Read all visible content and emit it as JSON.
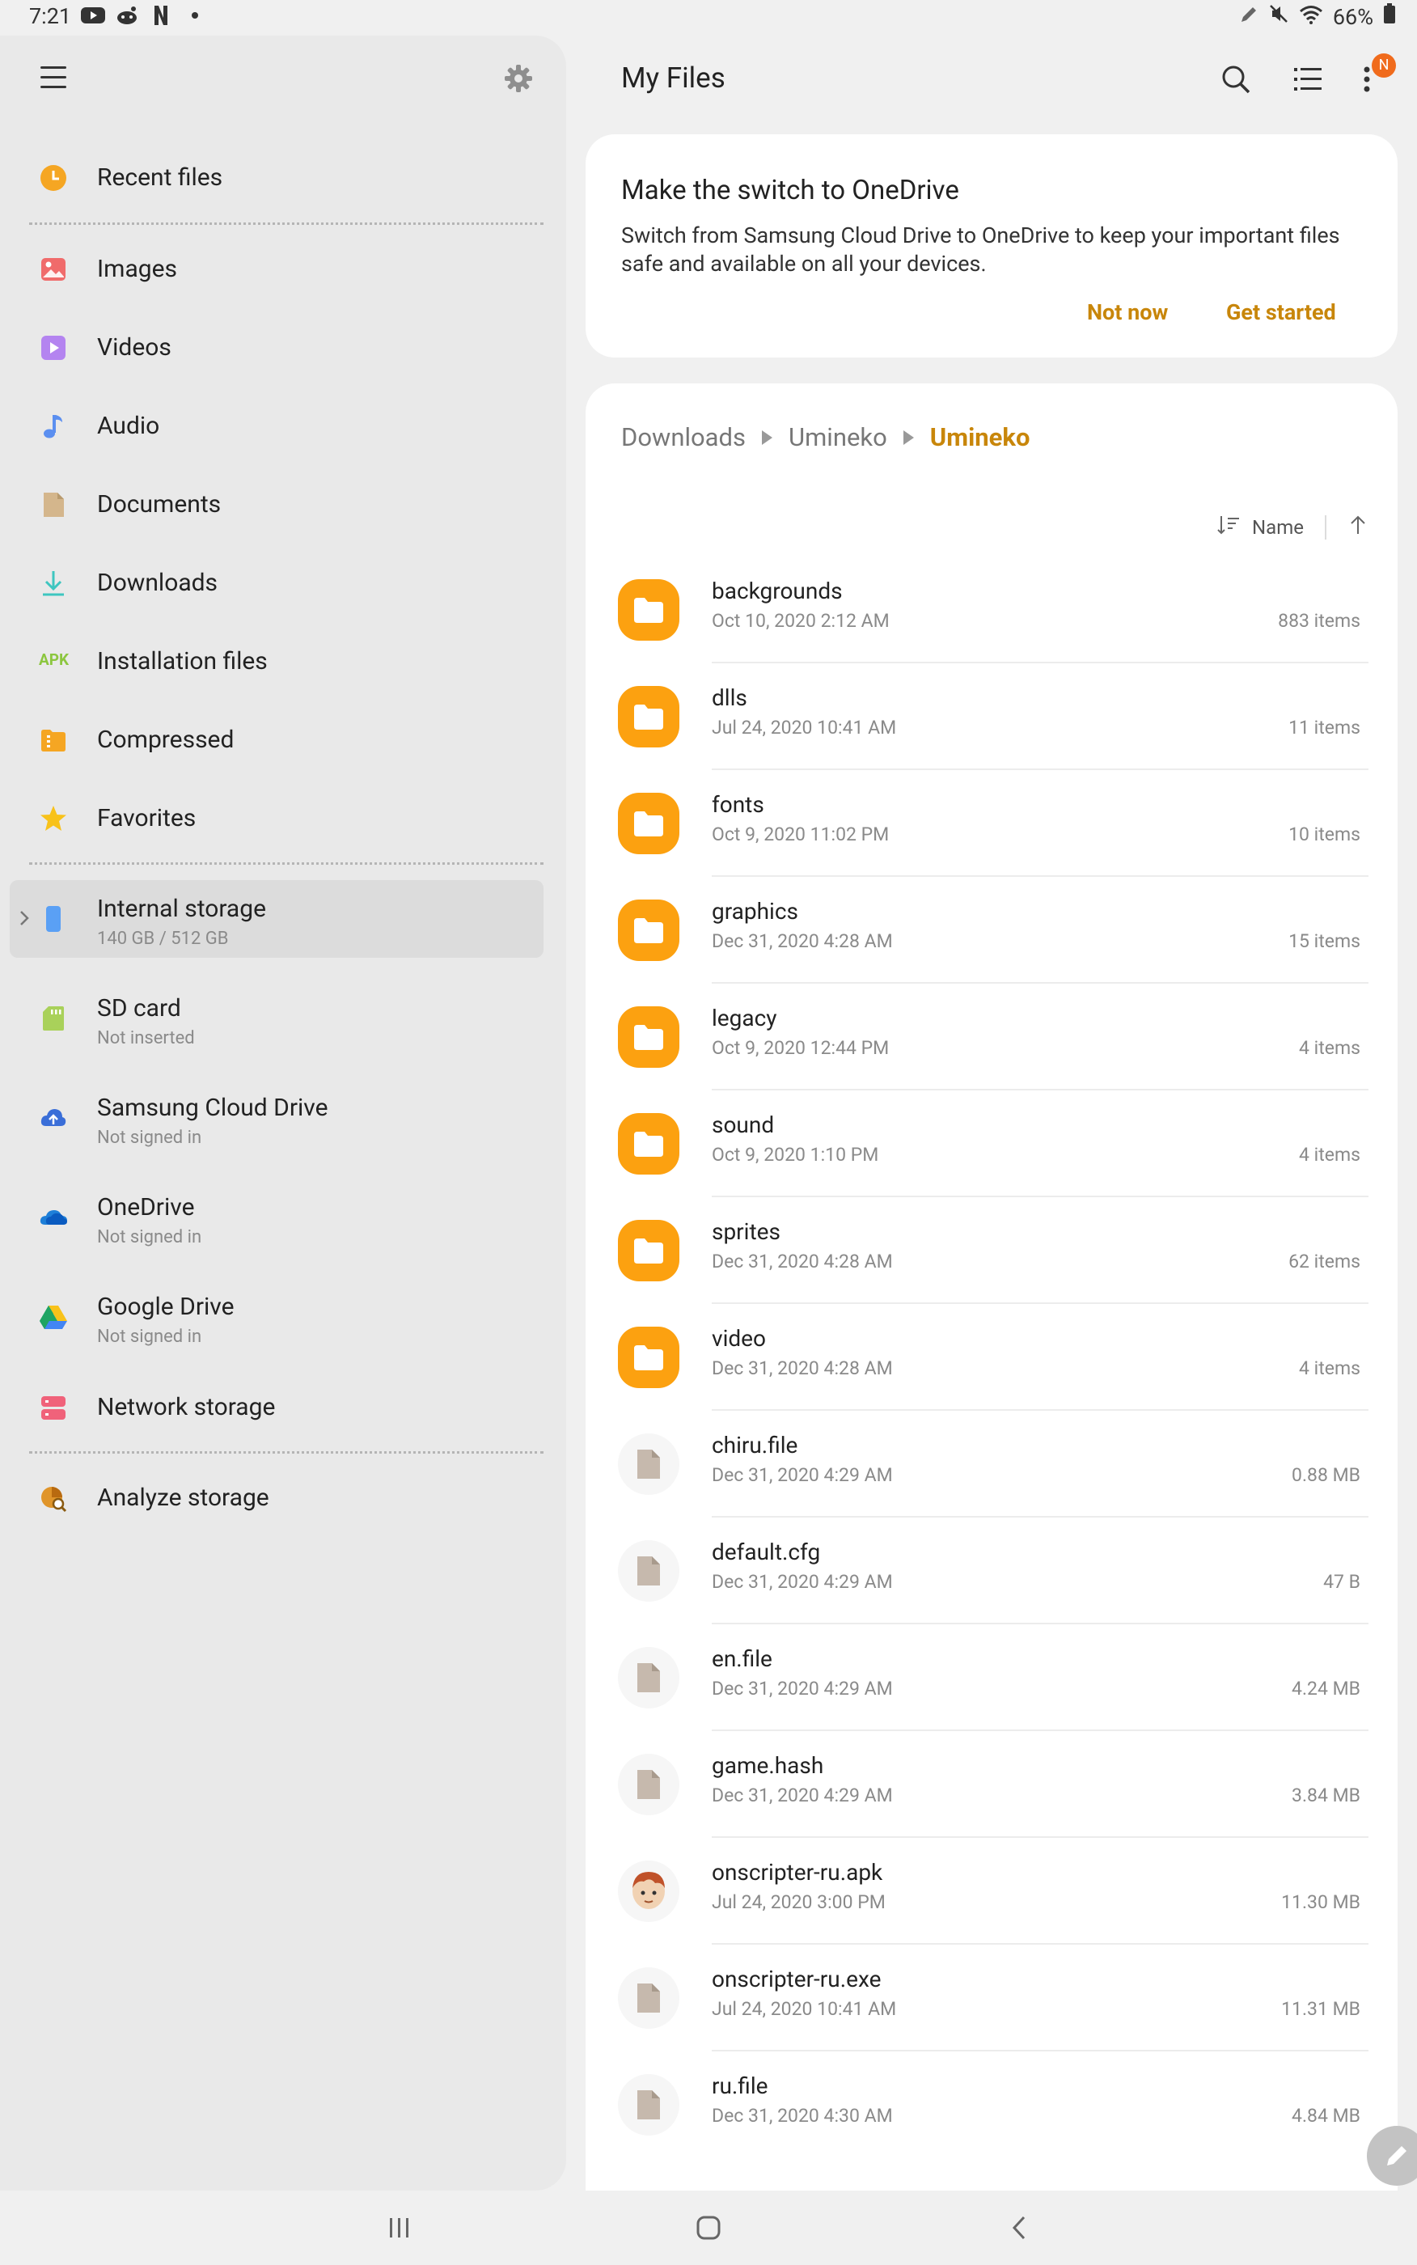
{
  "status": {
    "time": "7:21",
    "battery": "66%"
  },
  "drawer": {
    "items": [
      {
        "label": "Recent files",
        "icon": "clock-icon"
      },
      {
        "label": "Images",
        "icon": "image-icon"
      },
      {
        "label": "Videos",
        "icon": "video-icon"
      },
      {
        "label": "Audio",
        "icon": "music-note-icon"
      },
      {
        "label": "Documents",
        "icon": "document-icon"
      },
      {
        "label": "Downloads",
        "icon": "download-icon"
      },
      {
        "label": "Installation files",
        "icon": "apk-icon",
        "icon_text": "APK"
      },
      {
        "label": "Compressed",
        "icon": "zip-icon"
      },
      {
        "label": "Favorites",
        "icon": "star-icon"
      }
    ],
    "storage": [
      {
        "label": "Internal storage",
        "sub": "140 GB / 512 GB",
        "icon": "phone-icon"
      },
      {
        "label": "SD card",
        "sub": "Not inserted",
        "icon": "sd-card-icon"
      },
      {
        "label": "Samsung Cloud Drive",
        "sub": "Not signed in",
        "icon": "samsung-cloud-icon"
      },
      {
        "label": "OneDrive",
        "sub": "Not signed in",
        "icon": "onedrive-icon"
      },
      {
        "label": "Google Drive",
        "sub": "Not signed in",
        "icon": "google-drive-icon"
      },
      {
        "label": "Network storage",
        "icon": "network-storage-icon"
      }
    ],
    "analyze": {
      "label": "Analyze storage",
      "icon": "analyze-icon"
    }
  },
  "header": {
    "title": "My Files",
    "badge": "N"
  },
  "banner": {
    "title": "Make the switch to OneDrive",
    "body": "Switch from Samsung Cloud Drive to OneDrive to keep your important files safe and available on all your devices.",
    "not_now": "Not now",
    "get_started": "Get started"
  },
  "breadcrumb": [
    "Downloads",
    "Umineko",
    "Umineko"
  ],
  "sort": {
    "label": "Name"
  },
  "files": [
    {
      "name": "backgrounds",
      "date": "Oct 10, 2020 2:12 AM",
      "meta": "883 items",
      "type": "folder"
    },
    {
      "name": "dlls",
      "date": "Jul 24, 2020 10:41 AM",
      "meta": "11 items",
      "type": "folder"
    },
    {
      "name": "fonts",
      "date": "Oct 9, 2020 11:02 PM",
      "meta": "10 items",
      "type": "folder"
    },
    {
      "name": "graphics",
      "date": "Dec 31, 2020 4:28 AM",
      "meta": "15 items",
      "type": "folder"
    },
    {
      "name": "legacy",
      "date": "Oct 9, 2020 12:44 PM",
      "meta": "4 items",
      "type": "folder"
    },
    {
      "name": "sound",
      "date": "Oct 9, 2020 1:10 PM",
      "meta": "4 items",
      "type": "folder"
    },
    {
      "name": "sprites",
      "date": "Dec 31, 2020 4:28 AM",
      "meta": "62 items",
      "type": "folder"
    },
    {
      "name": "video",
      "date": "Dec 31, 2020 4:28 AM",
      "meta": "4 items",
      "type": "folder"
    },
    {
      "name": "chiru.file",
      "date": "Dec 31, 2020 4:29 AM",
      "meta": "0.88 MB",
      "type": "file"
    },
    {
      "name": "default.cfg",
      "date": "Dec 31, 2020 4:29 AM",
      "meta": "47 B",
      "type": "file"
    },
    {
      "name": "en.file",
      "date": "Dec 31, 2020 4:29 AM",
      "meta": "4.24 MB",
      "type": "file"
    },
    {
      "name": "game.hash",
      "date": "Dec 31, 2020 4:29 AM",
      "meta": "3.84 MB",
      "type": "file"
    },
    {
      "name": "onscripter-ru.apk",
      "date": "Jul 24, 2020 3:00 PM",
      "meta": "11.30 MB",
      "type": "apk"
    },
    {
      "name": "onscripter-ru.exe",
      "date": "Jul 24, 2020 10:41 AM",
      "meta": "11.31 MB",
      "type": "file"
    },
    {
      "name": "ru.file",
      "date": "Dec 31, 2020 4:30 AM",
      "meta": "4.84 MB",
      "type": "file"
    }
  ],
  "colors": {
    "accent": "#c8860a",
    "folder": "#fca110",
    "badge": "#f06b1c"
  }
}
